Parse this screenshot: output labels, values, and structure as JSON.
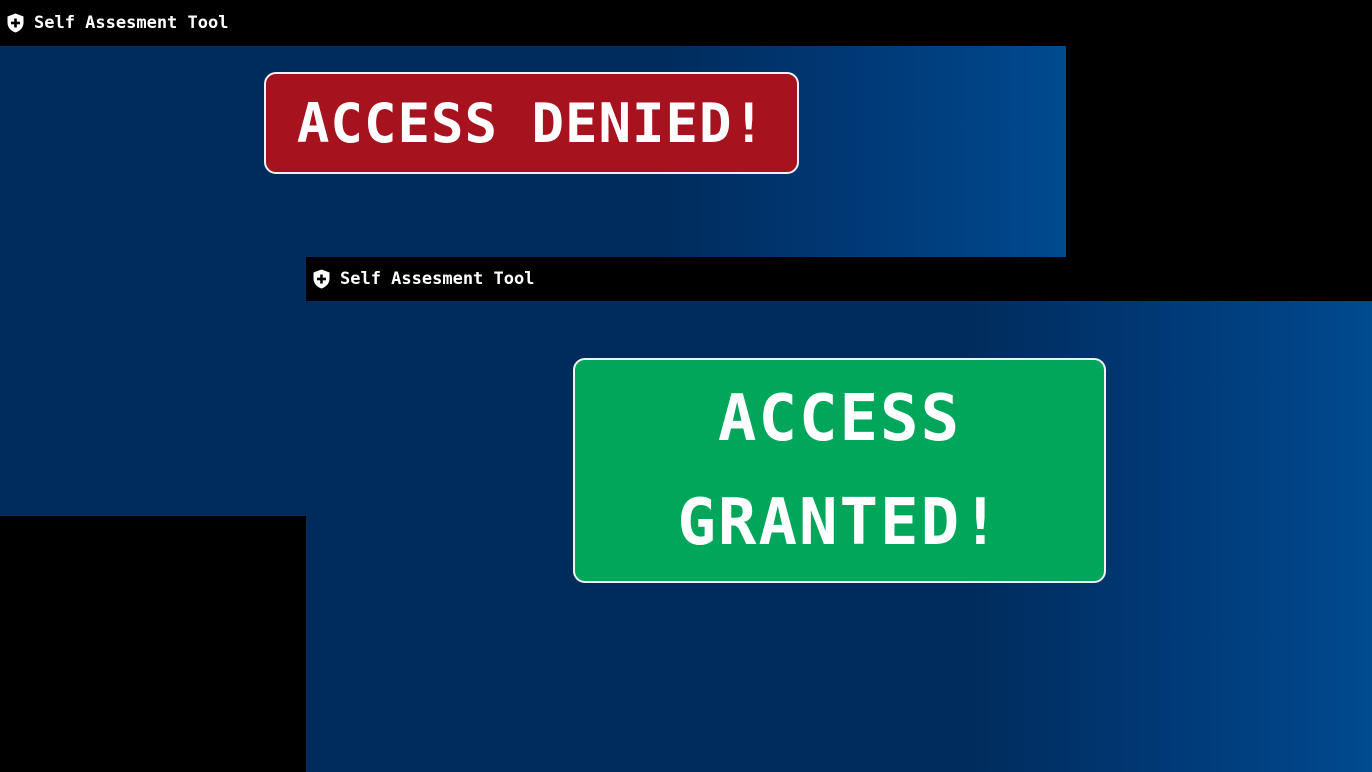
{
  "windows": {
    "denied": {
      "title": "Self Assesment Tool",
      "icon": "shield-plus-icon",
      "message": "ACCESS DENIED!",
      "message_color": "#a6121e"
    },
    "granted": {
      "title": "Self Assesment Tool",
      "icon": "shield-plus-icon",
      "message_line1": "ACCESS",
      "message_line2": "GRANTED!",
      "message_color": "#00a65a"
    }
  },
  "colors": {
    "background": "#002c5c",
    "background_gradient_end": "#004a8f",
    "titlebar": "#000000",
    "banner_border": "#f2f2f2",
    "text": "#ffffff"
  }
}
